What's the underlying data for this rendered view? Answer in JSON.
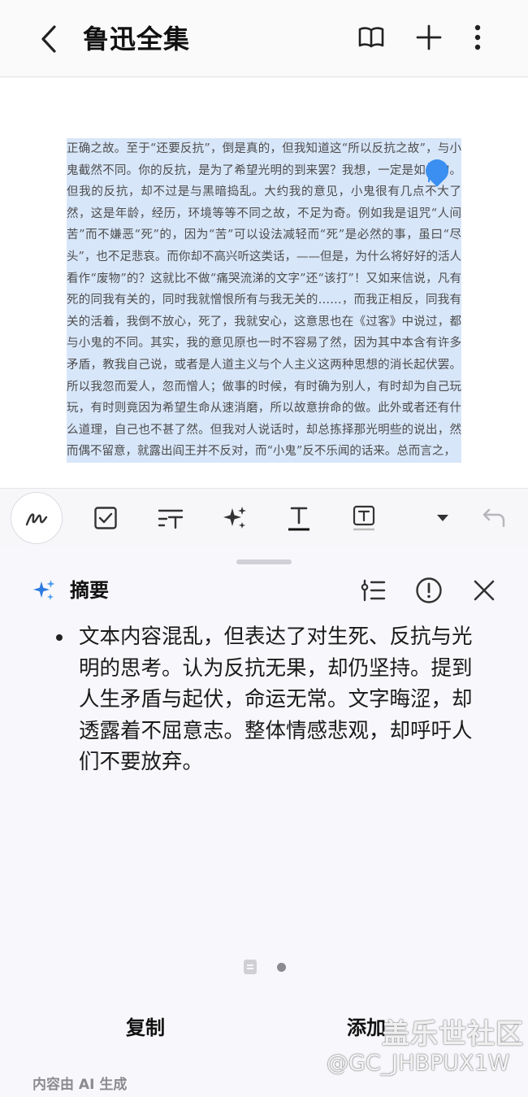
{
  "header": {
    "title": "鲁迅全集",
    "back_icon": "chevron-left-icon",
    "icons": [
      "book-open-icon",
      "plus-icon",
      "more-vertical-icon"
    ]
  },
  "document": {
    "text": "正确之故。至于“还要反抗”，倒是真的，但我知道这“所以反抗之故”，与小鬼截然不同。你的反抗，是为了希望光明的到来罢？我想，一定是如此的。但我的反抗，却不过是与黑暗捣乱。大约我的意见，小鬼很有几点不大了然，这是年龄，经历，环境等等不同之故，不足为奇。例如我是诅咒“人间苦”而不嫌恶“死”的，因为“苦”可以设法减轻而“死”是必然的事，虽曰“尽头”，也不足悲哀。而你却不高兴听这类话，——但是，为什么将好好的活人看作“废物”的？这就比不做“痛哭流涕的文字”还“该打”！又如来信说，凡有死的同我有关的，同时我就憎恨所有与我无关的……，而我正相反，同我有关的活着，我倒不放心，死了，我就安心，这意思也在《过客》中说过，都与小鬼的不同。其实，我的意见原也一时不容易了然，因为其中本含有许多矛盾，教我自己说，或者是人道主义与个人主义这两种思想的消长起伏罢。所以我忽而爱人，忽而憎人；做事的时候，有时确为别人，有时却为自己玩玩，有时则竟因为希望生命从速消磨，所以故意拚命的做。此外或者还有什么道理，自己也不甚了然。但我对人说话时，却总拣择那光明些的说出，然而偶不留意，就露出阎王并不反对，而“小鬼”反不乐闻的话来。总而言之，",
    "selection_color": "#d8e6f9",
    "cursor_color": "#3b8ff0"
  },
  "toolbar": {
    "tools": [
      "pen-icon",
      "checkbox-icon",
      "text-size-icon",
      "ai-sparkle-icon",
      "text-underline-icon",
      "text-box-icon",
      "dropdown-arrow-icon",
      "undo-icon"
    ]
  },
  "summary": {
    "title": "摘要",
    "title_icon": "ai-sparkle-icon",
    "action_icons": [
      "text-format-icon",
      "info-icon",
      "close-icon"
    ],
    "bullets": [
      "文本内容混乱，但表达了对生死、反抗与光明的思考。认为反抗无果，却仍坚持。提到人生矛盾与起伏，命运无常。文字晦涩，却透露着不屈意志。整体情感悲观，却呼吁人们不要放弃。"
    ],
    "pages": 2,
    "current_page": 2,
    "copy_label": "复制",
    "add_label": "添加",
    "ai_note": "内容由 AI 生成"
  },
  "watermark": {
    "line1": "盖乐世社区",
    "line2": "@GC_JHBPUX1W"
  },
  "colors": {
    "accent": "#3b8ff0",
    "sparkle_blue": "#2d7be0"
  }
}
